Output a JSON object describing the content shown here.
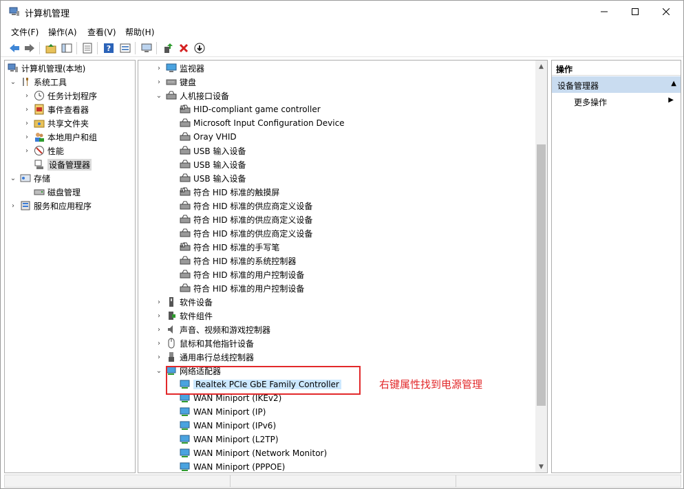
{
  "window": {
    "title": "计算机管理"
  },
  "menu": [
    "文件(F)",
    "操作(A)",
    "查看(V)",
    "帮助(H)"
  ],
  "left_tree": {
    "root": "计算机管理(本地)",
    "system_tools": "系统工具",
    "task_scheduler": "任务计划程序",
    "event_viewer": "事件查看器",
    "shared_folders": "共享文件夹",
    "local_users": "本地用户和组",
    "performance": "性能",
    "device_manager": "设备管理器",
    "storage": "存储",
    "disk_management": "磁盘管理",
    "services": "服务和应用程序"
  },
  "device_tree": {
    "monitors": "监视器",
    "keyboards": "键盘",
    "hid": "人机接口设备",
    "hid_children": [
      "HID-compliant game controller",
      "Microsoft Input Configuration Device",
      "Oray VHID",
      "USB 输入设备",
      "USB 输入设备",
      "USB 输入设备",
      "符合 HID 标准的触摸屏",
      "符合 HID 标准的供应商定义设备",
      "符合 HID 标准的供应商定义设备",
      "符合 HID 标准的供应商定义设备",
      "符合 HID 标准的手写笔",
      "符合 HID 标准的系统控制器",
      "符合 HID 标准的用户控制设备",
      "符合 HID 标准的用户控制设备"
    ],
    "software_devices": "软件设备",
    "software_components": "软件组件",
    "audio": "声音、视频和游戏控制器",
    "mice": "鼠标和其他指针设备",
    "usb": "通用串行总线控制器",
    "network": "网络适配器",
    "network_children": [
      "Realtek PCIe GbE Family Controller",
      "WAN Miniport (IKEv2)",
      "WAN Miniport (IP)",
      "WAN Miniport (IPv6)",
      "WAN Miniport (L2TP)",
      "WAN Miniport (Network Monitor)",
      "WAN Miniport (PPPOE)"
    ]
  },
  "actions": {
    "header": "操作",
    "section": "设备管理器",
    "more": "更多操作"
  },
  "annotation": "右键属性找到电源管理",
  "colors": {
    "accent_red": "#e2282a",
    "selection": "#cce8ff",
    "actions_band": "#c9dcf0"
  }
}
